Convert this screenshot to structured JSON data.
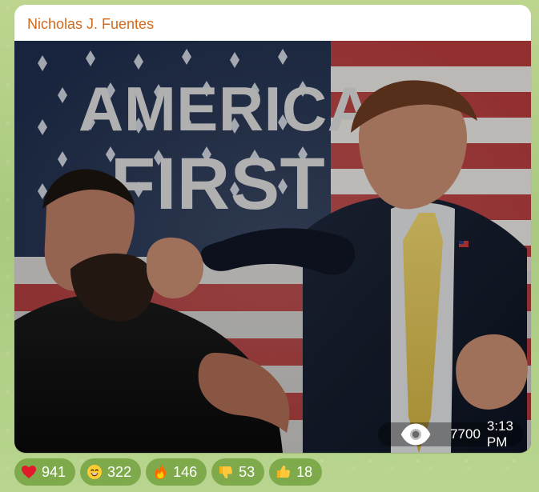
{
  "message": {
    "author": "Nicholas J. Fuentes",
    "photo": {
      "headline_line1": "AMERICA",
      "headline_line2": "FIRST"
    },
    "meta": {
      "views": "7700",
      "time": "3:13 PM"
    },
    "reactions": [
      {
        "icon": "heart-icon",
        "count": "941"
      },
      {
        "icon": "grin-icon",
        "count": "322"
      },
      {
        "icon": "fire-icon",
        "count": "146"
      },
      {
        "icon": "thumbs-down-icon",
        "count": "53"
      },
      {
        "icon": "thumbs-up-icon",
        "count": "18"
      }
    ]
  },
  "colors": {
    "author": "#d16a1c",
    "reaction_bg": "#7eaa4c",
    "bubble_bg": "#ffffff",
    "chat_bg": "#b9cf8c"
  }
}
